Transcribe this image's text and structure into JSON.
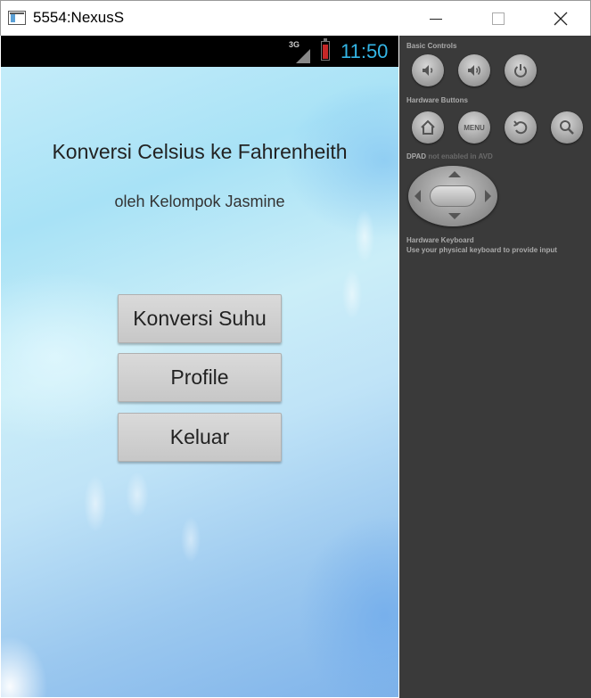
{
  "window": {
    "title": "5554:NexusS"
  },
  "statusbar": {
    "network": "3G",
    "time": "11:50",
    "clock_color": "#33b5e5"
  },
  "app": {
    "heading": "Konversi Celsius ke Fahrenheith",
    "subheading": "oleh Kelompok Jasmine",
    "buttons": {
      "konversi": "Konversi Suhu",
      "profile": "Profile",
      "keluar": "Keluar"
    }
  },
  "panel": {
    "basic_controls_label": "Basic Controls",
    "hardware_buttons_label": "Hardware Buttons",
    "menu_label": "MENU",
    "dpad_label": "DPAD",
    "dpad_note": "not enabled in AVD",
    "keyboard_label": "Hardware Keyboard",
    "keyboard_note": "Use your physical keyboard to provide input"
  }
}
